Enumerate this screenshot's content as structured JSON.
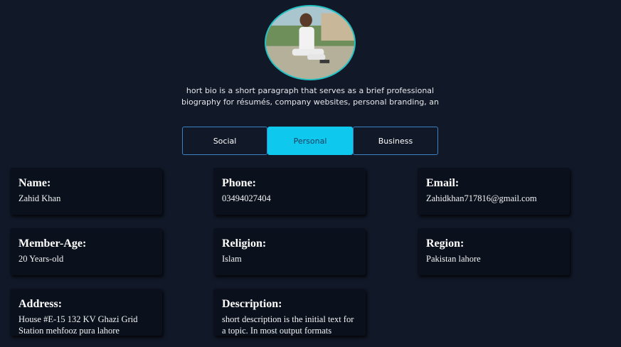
{
  "profile": {
    "avatar_alt": "Profile photo",
    "bio": "hort bio is a short paragraph that serves as a brief professional biography for résumés, company websites, personal branding, an"
  },
  "tabs": [
    {
      "label": "Social",
      "active": false
    },
    {
      "label": "Personal",
      "active": true
    },
    {
      "label": "Business",
      "active": false
    }
  ],
  "fields": {
    "name": {
      "label": "Name:",
      "value": "Zahid Khan"
    },
    "phone": {
      "label": "Phone:",
      "value": "03494027404"
    },
    "email": {
      "label": "Email:",
      "value": "Zahidkhan717816@gmail.com"
    },
    "member_age": {
      "label": "Member-Age:",
      "value": "20 Years-old"
    },
    "religion": {
      "label": "Religion:",
      "value": "Islam"
    },
    "region": {
      "label": "Region:",
      "value": "Pakistan lahore"
    },
    "address": {
      "label": "Address:",
      "value": "House #E-15 132 KV Ghazi Grid Station mehfooz pura lahore"
    },
    "description": {
      "label": "Description:",
      "value": "short description is the initial text for a topic. In most output formats"
    }
  },
  "colors": {
    "background": "#111827",
    "card": "#0b111c",
    "accent": "#0ec8ee",
    "tab_border": "#3b82c4"
  }
}
